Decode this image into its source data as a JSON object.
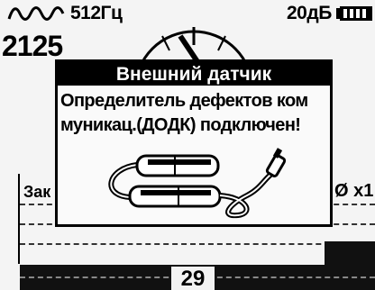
{
  "status": {
    "frequency": "512Гц",
    "gain": "20дБ",
    "wave_icon": "sine-wave-icon",
    "battery_icon": "battery-icon"
  },
  "reading": "2125",
  "background": {
    "mode_label": "Зак",
    "right_value": "Ø x1",
    "level": "29"
  },
  "dialog": {
    "title": "Внешний датчик",
    "message": "Определитель дефектов ком\nмуникац.(ДОДК) подключен!",
    "image_icon": "defect-detector-probe-icon"
  }
}
